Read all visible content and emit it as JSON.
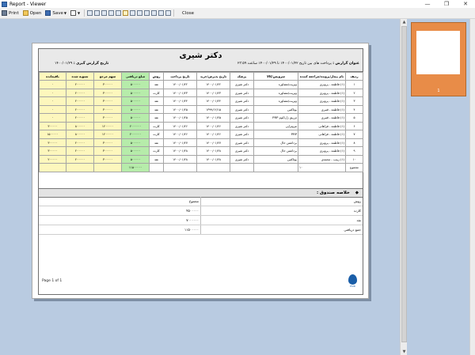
{
  "window": {
    "title": "Report - Viewer",
    "min_glyph": "—",
    "max_glyph": "❐",
    "close_glyph": "✕"
  },
  "toolbar": {
    "print": "Print",
    "open": "Open",
    "save": "Save",
    "close": "Close"
  },
  "report": {
    "title": "دکتر شیری",
    "info_label": "عنوان گزارش :",
    "info_text": "پرداخت های بین تاریخ ۱۴۰۰/۰۱/۲۲ تا ۱۴۰۰/۰۱/۲۹ ساعت ۲۳:۵۹",
    "date_label": "تاریخ گزارش گیری :",
    "date_value": "۱۴۰۰/۰۱/۲۹"
  },
  "table": {
    "headers": [
      "ردیف",
      "نام بیمار/پرونده/مراجعه کننده",
      "سرویس/کالا",
      "پزشک",
      "تاریخ پذیرش/خرید",
      "تاریخ پرداخت",
      "روش",
      "مبلغ دریافتی",
      "سهم مرجع",
      "تسویه شده",
      "باقیمانده"
    ],
    "rows": [
      [
        "۱",
        "(۱) فاطمه - پرویزی",
        "ویزیت/مشاوره",
        "دکتر شیری",
        "۱۴۰۰/۰۱/۲۲",
        "۱۴۰۰/۰۱/۲۲",
        "نقد",
        "۵۰۰۰۰۰",
        "۳۰۰۰۰۰",
        "۲۰۰۰۰۰",
        "۰"
      ],
      [
        "۲",
        "(۱) فاطمه - پرویزی",
        "ویزیت/مشاوره",
        "دکتر شیری",
        "۱۴۰۰/۰۱/۲۳",
        "۱۴۰۰/۰۱/۲۳",
        "کارت",
        "۵۰۰۰۰۰",
        "۳۰۰۰۰۰",
        "۲۰۰۰۰۰",
        "۰"
      ],
      [
        "۳",
        "(۱) فاطمه - پرویزی",
        "ویزیت/مشاوره",
        "دکتر شیری",
        "۱۴۰۰/۰۱/۲۴",
        "۱۴۰۰/۰۱/۲۴",
        "نقد",
        "۵۰۰۰۰۰",
        "۳۰۰۰۰۰",
        "۲۰۰۰۰۰",
        "۰"
      ],
      [
        "۴",
        "(۱) فاطمه - قنبری",
        "بوتاکس",
        "دکتر شیری",
        "۱۳۹۹/۱۲/۱۵",
        "۱۴۰۰/۰۱/۲۵",
        "نقد",
        "۵۰۰۰۰۰",
        "۳۰۰۰۰۰",
        "۲۰۰۰۰۰",
        "۰"
      ],
      [
        "۵",
        "(۱) فاطمه - قنبری",
        "تزریق ژل/کوم PRP",
        "دکتر شیری",
        "۱۴۰۰/۰۱/۲۵",
        "۱۴۰۰/۰۱/۲۵",
        "نقد",
        "۵۰۰۰۰۰",
        "۳۰۰۰۰۰",
        "۲۰۰۰۰۰",
        "۰"
      ],
      [
        "۶",
        "(۱) فاطمه - فراهانی",
        "مزوتراپی",
        "دکتر شیری",
        "۱۴۰۰/۰۱/۲۶",
        "۱۴۰۰/۰۱/۲۶",
        "کارت",
        "۲۰۰۰۰۰۰",
        "۱۲۰۰۰۰۰",
        "۸۰۰۰۰۰",
        "۳۰۰۰۰۰"
      ],
      [
        "۷",
        "(۱) فاطمه - فراهانی",
        "PRP",
        "دکتر شیری",
        "۱۴۰۰/۰۱/۲۶",
        "۱۴۰۰/۰۱/۲۶",
        "کارت",
        "۲۰۰۰۰۰۰",
        "۱۲۰۰۰۰۰",
        "۸۰۰۰۰۰",
        "۱۵۰۰۰۰۰"
      ],
      [
        "۸",
        "(۱) فاطمه - پرویزی",
        "برداشتن خال",
        "دکتر شیری",
        "۱۴۰۰/۰۱/۲۷",
        "۱۴۰۰/۰۱/۲۷",
        "نقد",
        "۵۰۰۰۰۰",
        "۳۰۰۰۰۰",
        "۲۰۰۰۰۰",
        "۳۰۰۰۰۰"
      ],
      [
        "۹",
        "(۱) فاطمه - پرویزی",
        "برداشتن خال",
        "دکتر شیری",
        "۱۴۰۰/۰۱/۲۸",
        "۱۴۰۰/۰۱/۲۸",
        "کارت",
        "۵۰۰۰۰۰",
        "۳۰۰۰۰۰",
        "۲۰۰۰۰۰",
        "۳۰۰۰۰۰"
      ],
      [
        "۱۰",
        "(۱) زینب - محمدی",
        "بوتاکس",
        "دکتر شیری",
        "۱۴۰۰/۰۱/۲۸",
        "۱۴۰۰/۰۱/۲۸",
        "نقد",
        "۵۰۰۰۰۰",
        "۳۰۰۰۰۰",
        "۲۰۰۰۰۰",
        "۲۰۰۰۰۰"
      ]
    ],
    "total_label": "مجموع",
    "total_value": "۱۰",
    "total_received": "۱۱۵۰۰۰۰۰"
  },
  "fund": {
    "title": "خلاصه صندوق :",
    "col_total": "مجموع",
    "rows": [
      {
        "label": "روش",
        "value": ""
      },
      {
        "label": "کارت",
        "value": "۴۵۰۰۰۰۰"
      },
      {
        "label": "نقد",
        "value": "۷۰۰۰۰۰۰"
      },
      {
        "label": "جمع دریافتی",
        "value": "۱۱۵۰۰۰۰۰"
      }
    ]
  },
  "footer": {
    "page": "Page 1 of 1",
    "logo_text": "ESIR"
  },
  "thumbnail": {
    "page_number": "1"
  },
  "colors": {
    "viewer_bg": "#b9cbe1",
    "yellow_col": "#fdf7bd",
    "green_col": "#b6ecaa",
    "thumb_orange": "#e88c48"
  }
}
